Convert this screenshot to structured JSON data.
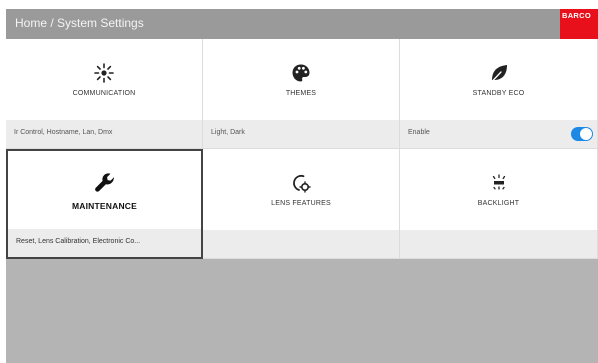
{
  "header": {
    "title": "Home / System Settings"
  },
  "brand": {
    "name": "BARCO",
    "color": "#e8101a"
  },
  "tiles": [
    {
      "name": "COMMUNICATION",
      "subtitle": "Ir Control, Hostname, Lan, Dmx",
      "icon": "communication-icon"
    },
    {
      "name": "THEMES",
      "subtitle": "Light, Dark",
      "icon": "palette-icon"
    },
    {
      "name": "STANDBY ECO",
      "subtitle": "Enable",
      "icon": "leaf-icon",
      "toggle_on": true
    },
    {
      "name": "MAINTENANCE",
      "subtitle": "Reset, Lens Calibration, Electronic Co...",
      "icon": "wrench-icon",
      "selected": true
    },
    {
      "name": "LENS FEATURES",
      "subtitle": "",
      "icon": "lens-settings-icon"
    },
    {
      "name": "BACKLIGHT",
      "subtitle": "",
      "icon": "backlight-icon"
    }
  ],
  "colors": {
    "header_bg": "#9a9a9a",
    "toggle_on": "#1e88e5",
    "background": "#b4b4b4"
  }
}
